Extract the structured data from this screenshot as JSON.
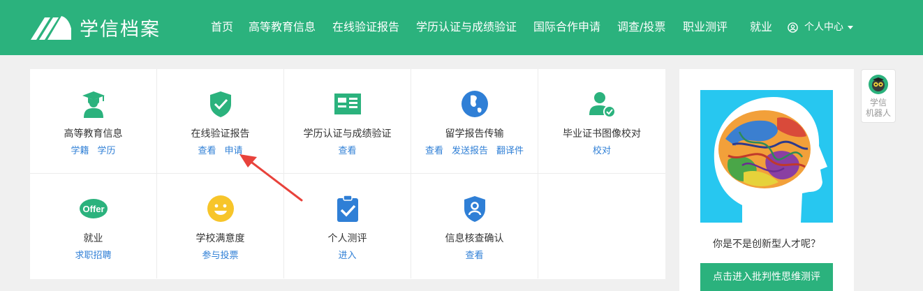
{
  "header": {
    "logo_text": "学信档案",
    "nav": [
      "首页",
      "高等教育信息",
      "在线验证报告",
      "学历认证与成绩验证",
      "国际合作申请",
      "调查/投票",
      "职业测评",
      "就业"
    ],
    "personal_center": "个人中心"
  },
  "services": [
    {
      "title": "高等教育信息",
      "links": [
        "学籍",
        "学历"
      ]
    },
    {
      "title": "在线验证报告",
      "links": [
        "查看",
        "申请"
      ]
    },
    {
      "title": "学历认证与成绩验证",
      "links": [
        "查看"
      ]
    },
    {
      "title": "留学报告传输",
      "links": [
        "查看",
        "发送报告",
        "翻译件"
      ]
    },
    {
      "title": "毕业证书图像校对",
      "links": [
        "校对"
      ]
    },
    {
      "title": "就业",
      "links": [
        "求职招聘"
      ],
      "badge": "Offer"
    },
    {
      "title": "学校满意度",
      "links": [
        "参与投票"
      ]
    },
    {
      "title": "个人测评",
      "links": [
        "进入"
      ]
    },
    {
      "title": "信息核查确认",
      "links": [
        "查看"
      ]
    }
  ],
  "side_card": {
    "question": "你是不是创新型人才呢？",
    "button": "点击进入批判性思维测评"
  },
  "robot": {
    "line1": "学信",
    "line2": "机器人"
  },
  "colors": {
    "brand": "#2bb27d",
    "link": "#2f7fd6",
    "annotation_arrow": "#e8423b"
  }
}
